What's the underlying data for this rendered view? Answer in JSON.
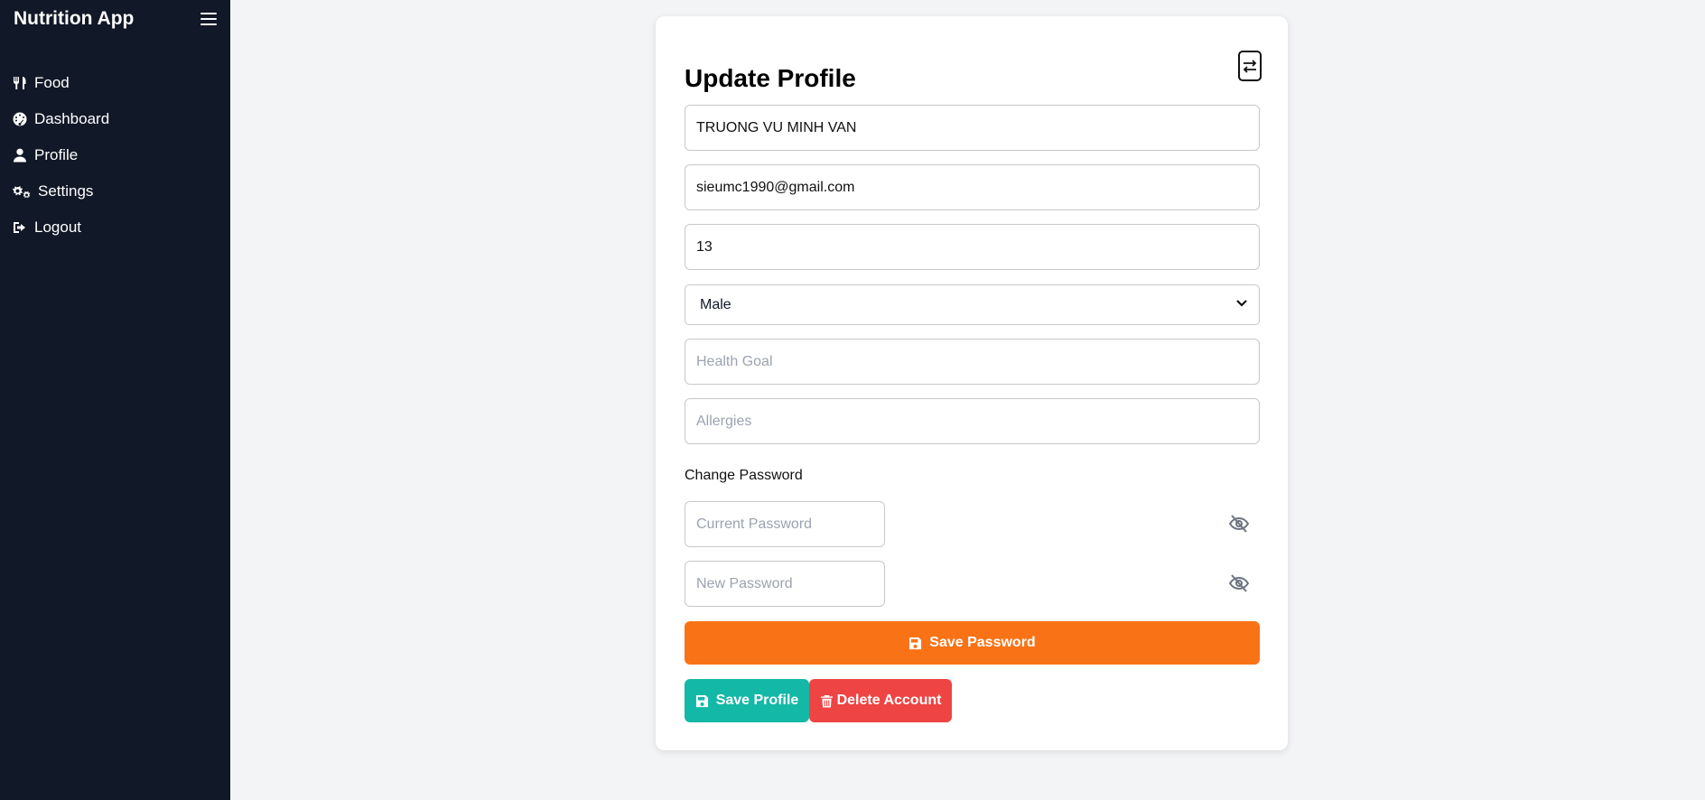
{
  "app": {
    "title": "Nutrition App"
  },
  "sidebar": {
    "items": [
      {
        "label": "Food",
        "icon": "utensils-icon"
      },
      {
        "label": "Dashboard",
        "icon": "gauge-icon"
      },
      {
        "label": "Profile",
        "icon": "user-icon"
      },
      {
        "label": "Settings",
        "icon": "cogs-icon"
      },
      {
        "label": "Logout",
        "icon": "sign-out-icon"
      }
    ]
  },
  "form": {
    "title": "Update Profile",
    "name_value": "TRUONG VU MINH VAN",
    "email_value": "sieumc1990@gmail.com",
    "age_value": "13",
    "gender_selected": "Male",
    "health_goal_placeholder": "Health Goal",
    "allergies_placeholder": "Allergies",
    "change_password_label": "Change Password",
    "current_password_placeholder": "Current Password",
    "new_password_placeholder": "New Password",
    "save_password_label": "Save Password",
    "save_profile_label": "Save Profile",
    "delete_account_label": "Delete Account"
  },
  "colors": {
    "sidebar_bg": "#111827",
    "page_bg": "#f3f4f6",
    "save_password": "#f97316",
    "save_profile": "#14b8a6",
    "delete_account": "#ef4444"
  }
}
